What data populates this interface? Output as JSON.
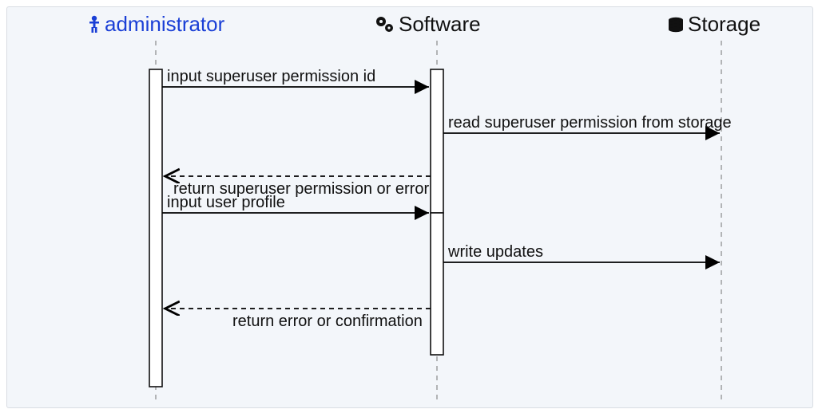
{
  "diagram": {
    "participants": {
      "administrator": {
        "label": "administrator",
        "icon": "person-icon"
      },
      "software": {
        "label": "Software",
        "icon": "gears-icon"
      },
      "storage": {
        "label": "Storage",
        "icon": "database-icon"
      }
    },
    "messages": {
      "m1": {
        "label": "input superuser permission id",
        "from": "administrator",
        "to": "software",
        "style": "solid"
      },
      "m2": {
        "label": "read superuser permission from storage",
        "from": "software",
        "to": "storage",
        "style": "solid"
      },
      "m3": {
        "label": "return superuser permission or error",
        "from": "software",
        "to": "administrator",
        "style": "dashed"
      },
      "m4": {
        "label": "input user profile",
        "from": "administrator",
        "to": "software",
        "style": "solid"
      },
      "m5": {
        "label": "write updates",
        "from": "software",
        "to": "storage",
        "style": "solid"
      },
      "m6": {
        "label": "return error or confirmation",
        "from": "software",
        "to": "administrator",
        "style": "dashed"
      }
    }
  }
}
